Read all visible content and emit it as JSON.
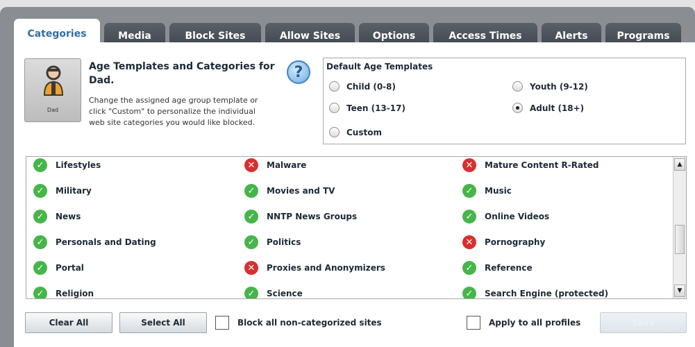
{
  "tabs": [
    {
      "label": "Categories",
      "active": true
    },
    {
      "label": "Media",
      "active": false
    },
    {
      "label": "Block Sites",
      "active": false
    },
    {
      "label": "Allow Sites",
      "active": false
    },
    {
      "label": "Options",
      "active": false
    },
    {
      "label": "Access Times",
      "active": false
    },
    {
      "label": "Alerts",
      "active": false
    },
    {
      "label": "Programs",
      "active": false
    }
  ],
  "profile": {
    "name": "Dad",
    "icon": "user-avatar-icon"
  },
  "header": {
    "title": "Age Templates and Categories for Dad.",
    "description": "Change the assigned age group template or click \"Custom\" to personalize the individual web site categories you would like blocked.",
    "help_label": "?"
  },
  "templates": {
    "heading": "Default Age Templates",
    "options": [
      {
        "label": "Child (0-8)",
        "selected": false
      },
      {
        "label": "Youth (9-12)",
        "selected": false
      },
      {
        "label": "Teen (13-17)",
        "selected": false
      },
      {
        "label": "Adult (18+)",
        "selected": true
      },
      {
        "label": "Custom",
        "selected": false
      }
    ]
  },
  "categories": [
    {
      "label": "Lifestyles",
      "status": "allowed"
    },
    {
      "label": "Malware",
      "status": "blocked"
    },
    {
      "label": "Mature Content R-Rated",
      "status": "blocked"
    },
    {
      "label": "Military",
      "status": "allowed"
    },
    {
      "label": "Movies and TV",
      "status": "allowed"
    },
    {
      "label": "Music",
      "status": "allowed"
    },
    {
      "label": "News",
      "status": "allowed"
    },
    {
      "label": "NNTP News Groups",
      "status": "allowed"
    },
    {
      "label": "Online Videos",
      "status": "allowed"
    },
    {
      "label": "Personals and Dating",
      "status": "allowed"
    },
    {
      "label": "Politics",
      "status": "allowed"
    },
    {
      "label": "Pornography",
      "status": "blocked"
    },
    {
      "label": "Portal",
      "status": "allowed"
    },
    {
      "label": "Proxies and Anonymizers",
      "status": "blocked"
    },
    {
      "label": "Reference",
      "status": "allowed"
    },
    {
      "label": "Religion",
      "status": "allowed"
    },
    {
      "label": "Science",
      "status": "allowed"
    },
    {
      "label": "Search Engine (protected)",
      "status": "allowed"
    }
  ],
  "footer": {
    "clear_all": "Clear All",
    "select_all": "Select All",
    "block_uncategorized": {
      "label": "Block all non-categorized sites",
      "checked": false
    },
    "apply_all_profiles": {
      "label": "Apply to all profiles",
      "checked": false
    },
    "save": "Save"
  },
  "colors": {
    "tab_active_text": "#2f6fa3",
    "tab_inactive_bg": "#4a5058",
    "allowed": "#46b54a",
    "blocked": "#d82f2f"
  }
}
